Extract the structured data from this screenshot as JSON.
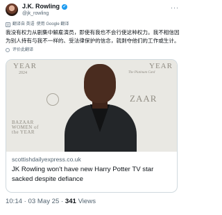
{
  "author": {
    "name": "J.K. Rowling",
    "handle": "@jk_rowling",
    "verified_color": "#1d9bf0"
  },
  "header": {
    "more_icon": "more-icon"
  },
  "translate": {
    "label": "翻译自 英语",
    "suffix": "使用 Google 翻译"
  },
  "tweet": {
    "text": "我没有权力从剧集中解雇演员，即使有我也不会行使这种权力。我不相信因为别人持有与我不一样的、受法律保护的信念，就剥夺他们的工作或生计。"
  },
  "reply_prompt": "评价此翻译",
  "link_card": {
    "image_text": {
      "year_left": "YEAR",
      "year_left_num": "2024",
      "bazaar_left": "BAZAAR WOMEN of the YEAR",
      "year_right": "YEAR",
      "bazaar_right": "ZAAR",
      "platinum": "The Platinum Card"
    },
    "domain": "scottishdailyexpress.co.uk",
    "title": "JK Rowling won't have new Harry Potter TV star sacked despite defiance"
  },
  "meta": {
    "time": "10:14",
    "sep": " · ",
    "date": "03 May 25",
    "sep2": " · ",
    "views_count": "341",
    "views_label": " Views"
  }
}
